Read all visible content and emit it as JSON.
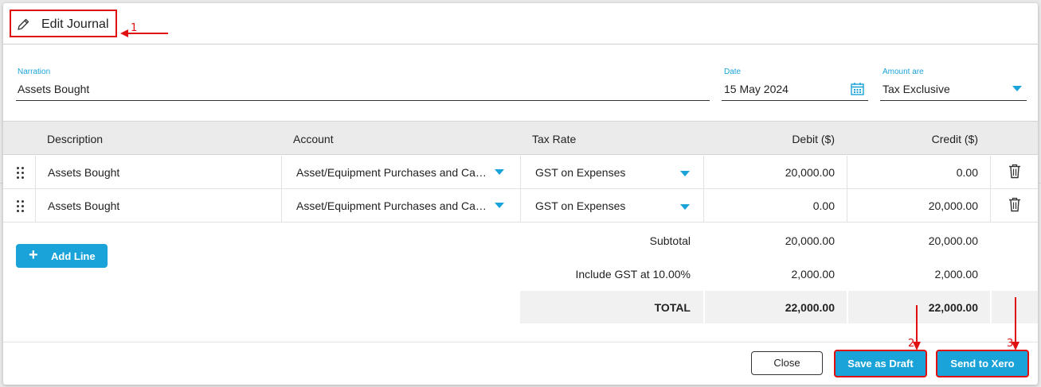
{
  "dialog": {
    "title": "Edit Journal"
  },
  "annotations": {
    "n1": "1",
    "n2": "2",
    "n3": "3",
    "color": "#e01010"
  },
  "form": {
    "narration_label": "Narration",
    "narration_value": "Assets Bought",
    "date_label": "Date",
    "date_value": "15 May 2024",
    "amount_label": "Amount are",
    "amount_value": "Tax Exclusive"
  },
  "table": {
    "headers": [
      "Description",
      "Account",
      "Tax Rate",
      "Debit ($)",
      "Credit ($)"
    ],
    "rows": [
      {
        "description": "Assets Bought",
        "account": "Asset/Equipment Purchases and Capital Expenses",
        "tax_rate": "GST on Expenses",
        "debit": "20,000.00",
        "credit": "0.00"
      },
      {
        "description": "Assets Bought",
        "account": "Asset/Equipment Purchases and Capital Expenses",
        "tax_rate": "GST on Expenses",
        "debit": "0.00",
        "credit": "20,000.00"
      }
    ]
  },
  "add_line_label": "Add Line",
  "summary": {
    "subtotal_label": "Subtotal",
    "subtotal_debit": "20,000.00",
    "subtotal_credit": "20,000.00",
    "gst_label": "Include GST at 10.00%",
    "gst_debit": "2,000.00",
    "gst_credit": "2,000.00",
    "total_label": "TOTAL",
    "total_debit": "22,000.00",
    "total_credit": "22,000.00"
  },
  "footer": {
    "close_label": "Close",
    "draft_label": "Save as Draft",
    "send_label": "Send to Xero"
  },
  "colors": {
    "accent": "#1aa3d8",
    "annotation": "#e01010"
  }
}
